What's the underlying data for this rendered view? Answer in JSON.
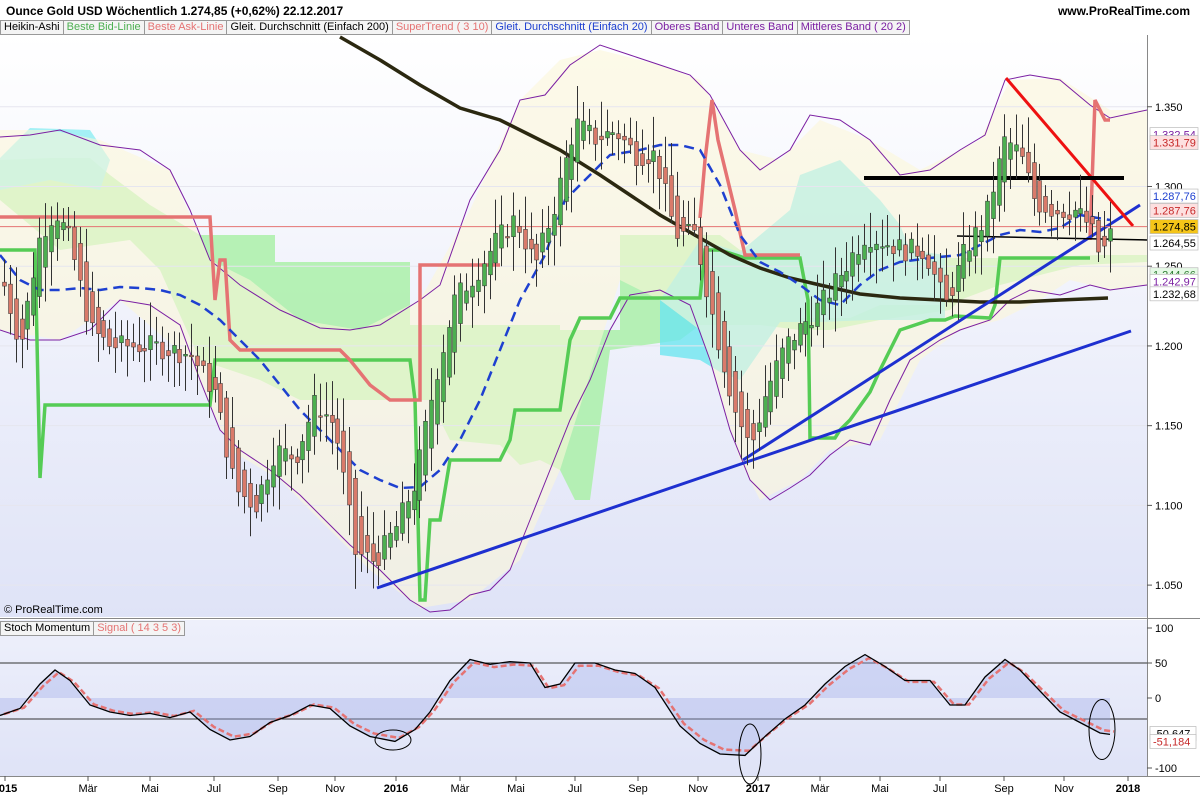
{
  "header": {
    "title": "Ounce Gold USD   Wöchentlich   1.274,85 (+0,62%)   22.12.2017",
    "site": "www.ProRealTime.com"
  },
  "legend_main": [
    {
      "label": "Heikin-Ashi",
      "color": "#000000"
    },
    {
      "label": "Beste Bid-Linie",
      "color": "#4caf50"
    },
    {
      "label": "Beste Ask-Linie",
      "color": "#e57373"
    },
    {
      "label": "Gleit. Durchschnitt (Einfach 200)",
      "color": "#000000"
    },
    {
      "label": "SuperTrend ( 3 10)",
      "color": "#e57373"
    },
    {
      "label": "Gleit. Durchschnitt (Einfach 20)",
      "color": "#1e40d0"
    },
    {
      "label": "Oberes Band",
      "color": "#7b1fa2"
    },
    {
      "label": "Unteres Band",
      "color": "#7b1fa2"
    },
    {
      "label": "Mittleres Band ( 20 2)",
      "color": "#7b1fa2"
    }
  ],
  "legend_osc": [
    {
      "label": "Stoch Momentum",
      "color": "#000000"
    },
    {
      "label": "Signal ( 14 3 5 3)",
      "color": "#e57373"
    }
  ],
  "copyright": "© ProRealTime.com",
  "chart_data": [
    {
      "type": "candlestick",
      "title": "Ounce Gold USD",
      "ylim": [
        1.03,
        1.395
      ],
      "yticks": [
        "1.350",
        "1.300",
        "1.250",
        "1.200",
        "1.150",
        "1.100",
        "1.050"
      ],
      "ytick_values": [
        1350,
        1300,
        1250,
        1200,
        1150,
        1100,
        1050
      ],
      "xticks": [
        "2015",
        "Mär",
        "Mai",
        "Jul",
        "Sep",
        "Nov",
        "2016",
        "Mär",
        "Mai",
        "Jul",
        "Sep",
        "Nov",
        "2017",
        "Mär",
        "Mai",
        "Jul",
        "Sep",
        "Nov",
        "2018"
      ],
      "price_labels": [
        {
          "text": "1.332,54",
          "value": 1332.54,
          "bg": "#ffffff",
          "fg": "#7b1fa2"
        },
        {
          "text": "1.331,79",
          "value": 1327.5,
          "bg": "#fde0e0",
          "fg": "#c62828"
        },
        {
          "text": "1.287,76",
          "value": 1294,
          "bg": "#ffffff",
          "fg": "#1e40d0"
        },
        {
          "text": "1.287,76",
          "value": 1285,
          "bg": "#fde0e0",
          "fg": "#c62828"
        },
        {
          "text": "1.274,85",
          "value": 1274.85,
          "bg": "#f5c518",
          "fg": "#000000"
        },
        {
          "text": "1.264,55",
          "value": 1264.55,
          "bg": "#ffffff",
          "fg": "#000000"
        },
        {
          "text": "1.244,66",
          "value": 1244.66,
          "bg": "#e5f9e5",
          "fg": "#2e7d32"
        },
        {
          "text": "1.242,97",
          "value": 1240.5,
          "bg": "#ffffff",
          "fg": "#7b1fa2"
        },
        {
          "text": "1.232,68",
          "value": 1232.68,
          "bg": "#ffffff",
          "fg": "#000000"
        }
      ],
      "last_price": 1274.85
    },
    {
      "type": "line",
      "title": "Stoch Momentum",
      "ylim": [
        -100,
        100
      ],
      "yticks": [
        "100",
        "50",
        "0",
        "-100"
      ],
      "ytick_values": [
        100,
        50,
        0,
        -100
      ],
      "series": [
        {
          "name": "Stoch Momentum"
        },
        {
          "name": "Signal ( 14 3 5 3)"
        }
      ],
      "value_labels": [
        {
          "text": "-50,647",
          "value": -50.647,
          "fg": "#000000"
        },
        {
          "text": "-51,184",
          "value": -62,
          "fg": "#c62828"
        }
      ]
    }
  ]
}
